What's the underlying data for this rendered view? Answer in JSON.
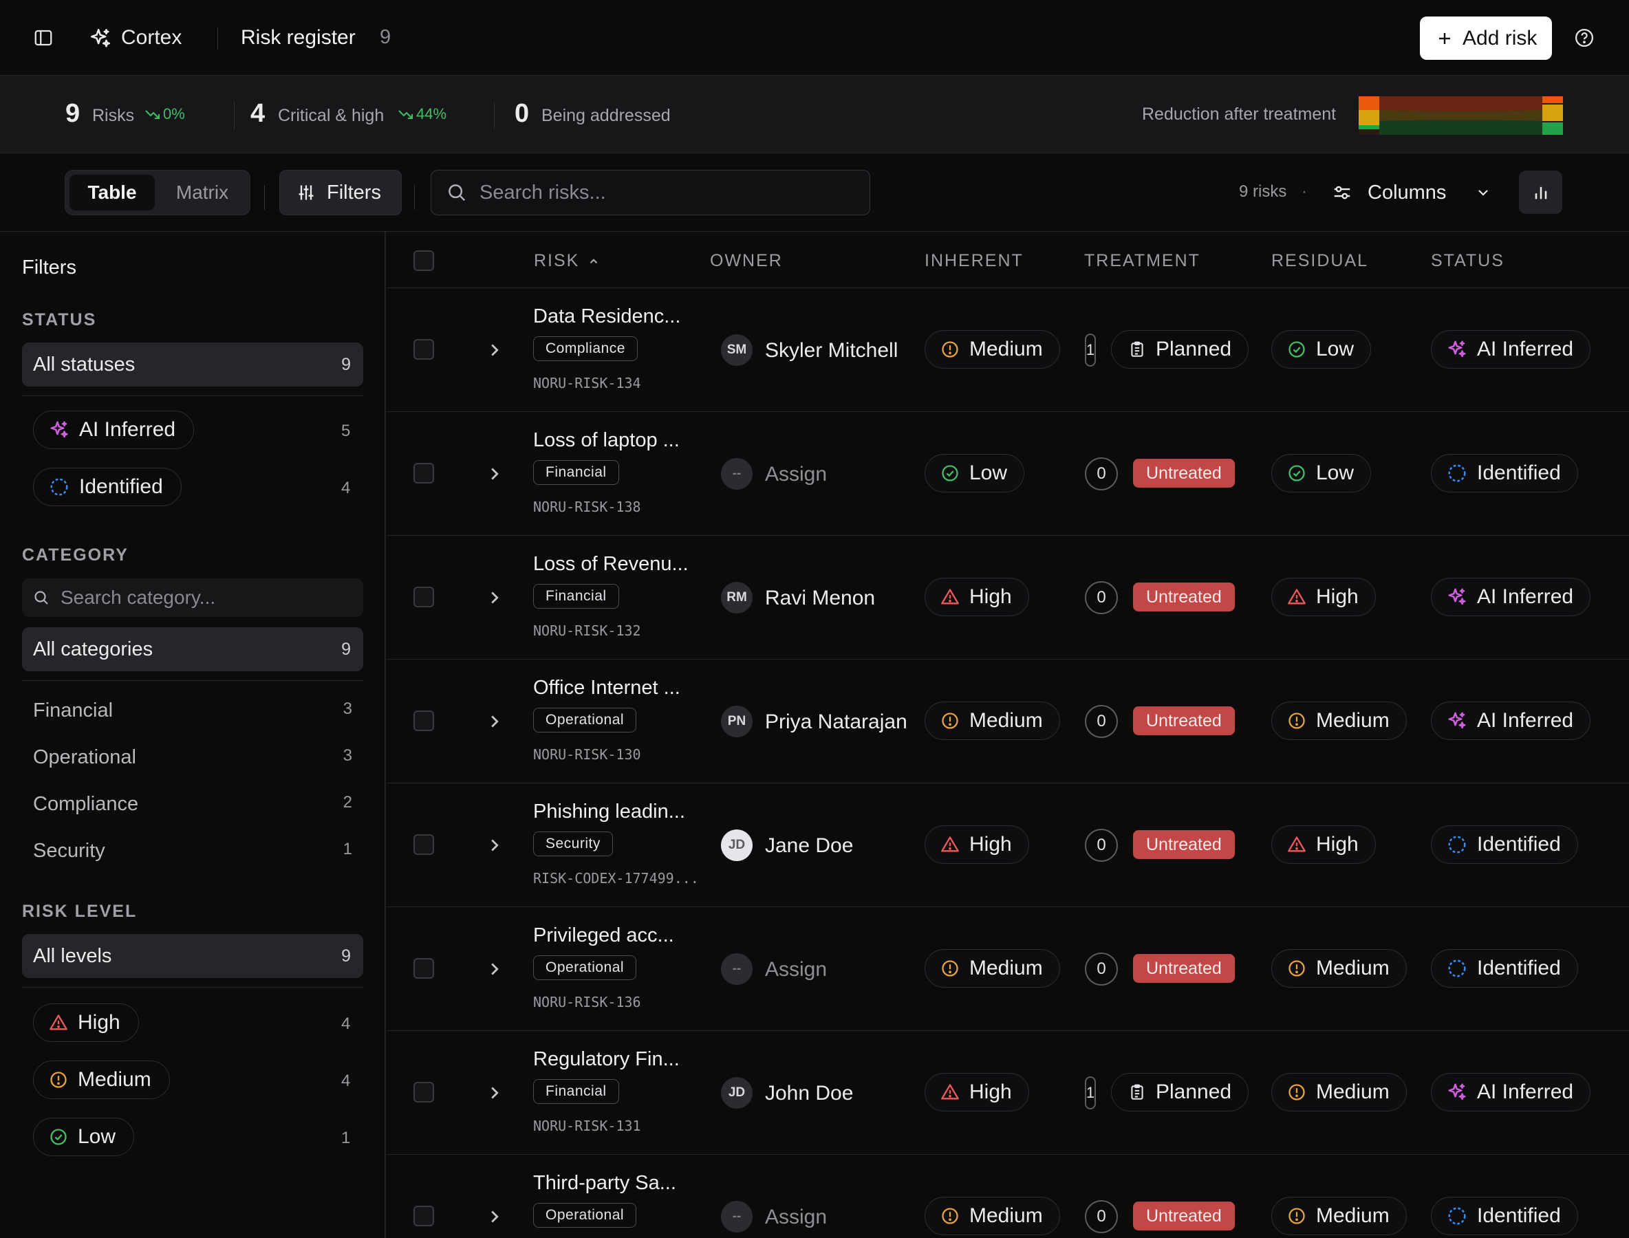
{
  "app": {
    "name": "Cortex",
    "page_title": "Risk register",
    "page_count": "9",
    "add_button": "Add risk"
  },
  "stats": [
    {
      "value": "9",
      "label": "Risks",
      "delta": "0%"
    },
    {
      "value": "4",
      "label": "Critical & high",
      "delta": "44%"
    },
    {
      "value": "0",
      "label": "Being addressed"
    }
  ],
  "reduction": {
    "label": "Reduction after treatment",
    "colors": {
      "high": "#e8590c",
      "medium": "#d6a20d",
      "low": "#22a34a"
    }
  },
  "toolbar": {
    "view_tabs": [
      "Table",
      "Matrix"
    ],
    "active_view": "Table",
    "filters_label": "Filters",
    "search_placeholder": "Search risks...",
    "risk_count": "9 risks",
    "separator": "·",
    "columns_label": "Columns"
  },
  "sidebar": {
    "title": "Filters",
    "status": {
      "heading": "STATUS",
      "all": {
        "label": "All statuses",
        "count": "9"
      },
      "items": [
        {
          "label": "AI Inferred",
          "count": "5",
          "icon": "sparkle-icon"
        },
        {
          "label": "Identified",
          "count": "4",
          "icon": "dashed-circle-icon"
        }
      ]
    },
    "category": {
      "heading": "CATEGORY",
      "search_placeholder": "Search category...",
      "all": {
        "label": "All categories",
        "count": "9"
      },
      "items": [
        {
          "label": "Financial",
          "count": "3"
        },
        {
          "label": "Operational",
          "count": "3"
        },
        {
          "label": "Compliance",
          "count": "2"
        },
        {
          "label": "Security",
          "count": "1"
        }
      ]
    },
    "risk_level": {
      "heading": "RISK LEVEL",
      "all": {
        "label": "All levels",
        "count": "9"
      },
      "items": [
        {
          "label": "High",
          "count": "4",
          "icon": "warning-triangle-icon"
        },
        {
          "label": "Medium",
          "count": "4",
          "icon": "exclamation-circle-icon"
        },
        {
          "label": "Low",
          "count": "1",
          "icon": "check-circle-icon"
        }
      ]
    }
  },
  "table": {
    "columns": [
      "RISK",
      "OWNER",
      "INHERENT",
      "TREATMENT",
      "RESIDUAL",
      "STATUS"
    ],
    "sort": {
      "column": "RISK",
      "direction": "asc"
    },
    "rows": [
      {
        "name": "Data Residenc...",
        "category": "Compliance",
        "id": "NORU-RISK-134",
        "initials": "SM",
        "owner": "Skyler Mitchell",
        "inherent": "Medium",
        "treatment_count": "1",
        "treatment": "Planned",
        "residual": "Low",
        "status": "AI Inferred"
      },
      {
        "name": "Loss of laptop ...",
        "category": "Financial",
        "id": "NORU-RISK-138",
        "initials": "--",
        "owner": "Assign",
        "inherent": "Low",
        "treatment_count": "0",
        "treatment": "Untreated",
        "residual": "Low",
        "status": "Identified"
      },
      {
        "name": "Loss of Revenu...",
        "category": "Financial",
        "id": "NORU-RISK-132",
        "initials": "RM",
        "owner": "Ravi Menon",
        "inherent": "High",
        "treatment_count": "0",
        "treatment": "Untreated",
        "residual": "High",
        "status": "AI Inferred"
      },
      {
        "name": "Office Internet ...",
        "category": "Operational",
        "id": "NORU-RISK-130",
        "initials": "PN",
        "owner": "Priya Natarajan",
        "inherent": "Medium",
        "treatment_count": "0",
        "treatment": "Untreated",
        "residual": "Medium",
        "status": "AI Inferred"
      },
      {
        "name": "Phishing leadin...",
        "category": "Security",
        "id": "RISK-CODEX-177499...",
        "initials": "JD",
        "owner": "Jane Doe",
        "inherent": "High",
        "treatment_count": "0",
        "treatment": "Untreated",
        "residual": "High",
        "status": "Identified"
      },
      {
        "name": "Privileged acc...",
        "category": "Operational",
        "id": "NORU-RISK-136",
        "initials": "--",
        "owner": "Assign",
        "inherent": "Medium",
        "treatment_count": "0",
        "treatment": "Untreated",
        "residual": "Medium",
        "status": "Identified"
      },
      {
        "name": "Regulatory Fin...",
        "category": "Financial",
        "id": "NORU-RISK-131",
        "initials": "JD",
        "owner": "John Doe",
        "inherent": "High",
        "treatment_count": "1",
        "treatment": "Planned",
        "residual": "Medium",
        "status": "AI Inferred"
      },
      {
        "name": "Third-party Sa...",
        "category": "Operational",
        "id": "",
        "initials": "--",
        "owner": "Assign",
        "inherent": "Medium",
        "treatment_count": "0",
        "treatment": "Untreated",
        "residual": "Medium",
        "status": "Identified"
      }
    ]
  }
}
